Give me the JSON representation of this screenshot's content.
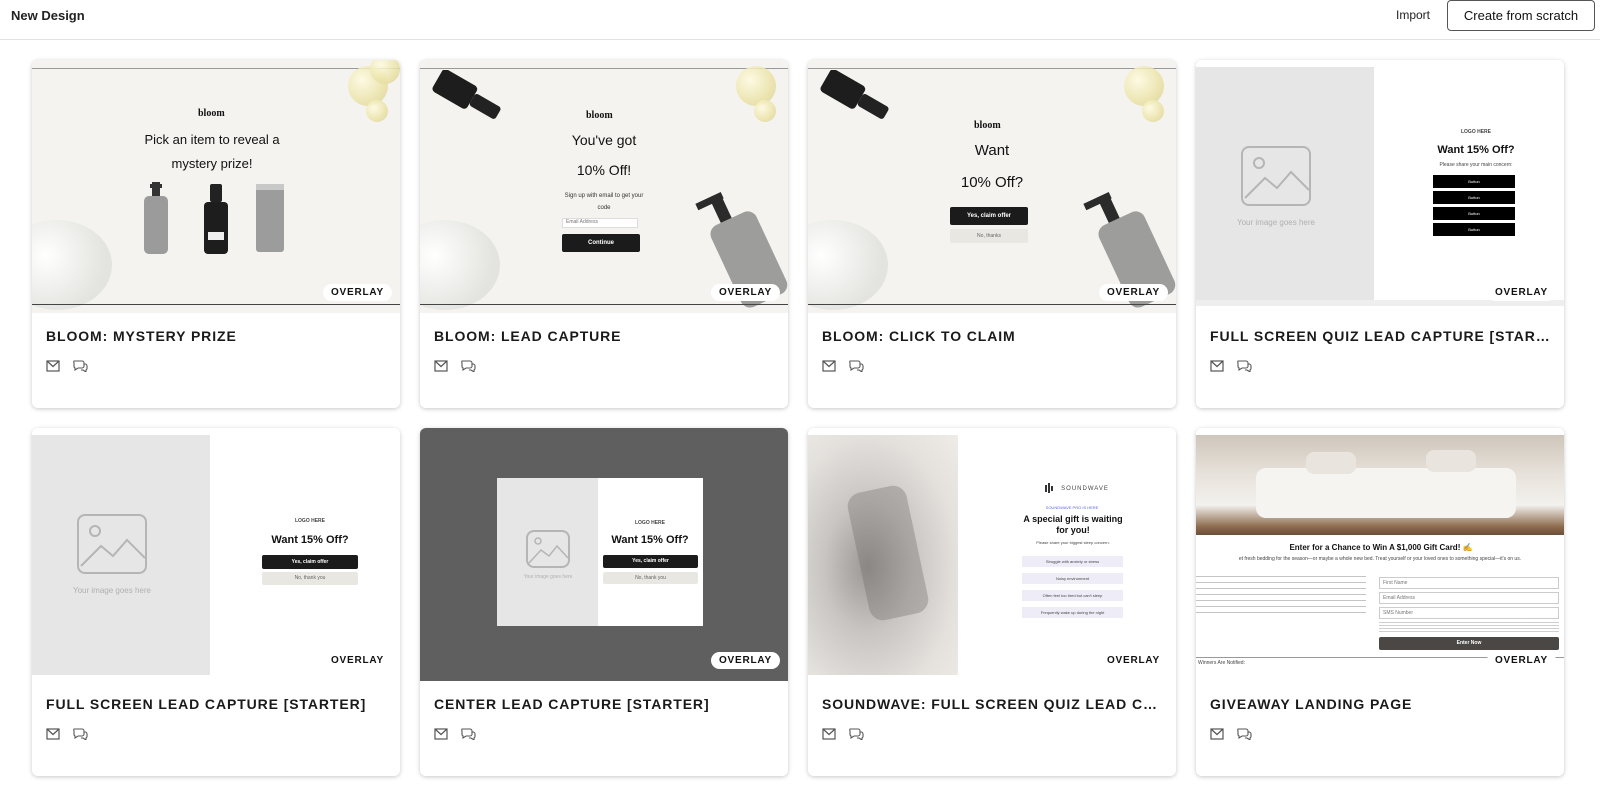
{
  "topbar": {
    "title": "New Design",
    "import_label": "Import",
    "create_label": "Create from scratch"
  },
  "cards": [
    {
      "title": "BLOOM: MYSTERY PRIZE",
      "badge": "OVERLAY",
      "preview": {
        "brand": "bloom",
        "headline": "Pick an item to reveal a mystery prize!"
      }
    },
    {
      "title": "BLOOM: LEAD CAPTURE",
      "badge": "OVERLAY",
      "preview": {
        "brand": "bloom",
        "line1": "You've got",
        "line2": "10% Off!",
        "sub": "Sign up with email to get your code",
        "input": "Email Address",
        "button": "Continue"
      }
    },
    {
      "title": "BLOOM: CLICK TO CLAIM",
      "badge": "OVERLAY",
      "preview": {
        "brand": "bloom",
        "line1": "Want",
        "line2": "10% Off?",
        "button": "Yes, claim offer",
        "secondary": "No, thanks"
      }
    },
    {
      "title": "FULL SCREEN QUIZ LEAD CAPTURE [STARTER]",
      "badge": "OVERLAY",
      "preview": {
        "logo": "LOGO HERE",
        "headline": "Want 15% Off?",
        "sub": "Please share your main concern:",
        "buttons": [
          "Button",
          "Button",
          "Button",
          "Button"
        ],
        "image_caption": "Your image goes here"
      }
    },
    {
      "title": "FULL SCREEN LEAD CAPTURE [STARTER]",
      "badge": "OVERLAY",
      "preview": {
        "logo": "LOGO HERE",
        "headline": "Want 15% Off?",
        "button": "Yes, claim offer",
        "secondary": "No, thank you",
        "image_caption": "Your image goes here"
      }
    },
    {
      "title": "CENTER LEAD CAPTURE [STARTER]",
      "badge": "OVERLAY",
      "preview": {
        "logo": "LOGO HERE",
        "headline": "Want 15% Off?",
        "button": "Yes, claim offer",
        "secondary": "No, thank you",
        "image_caption": "Your image goes here"
      }
    },
    {
      "title": "SOUNDWAVE: FULL SCREEN QUIZ LEAD CAPTU...",
      "badge": "OVERLAY",
      "preview": {
        "brand": "SOUNDWAVE",
        "kicker": "SOUNDWAVE PRO IS HERE",
        "headline": "A special gift is waiting for you!",
        "sub": "Please share your biggest sleep concern:",
        "options": [
          "Struggle with anxiety or stress",
          "Noisy environment",
          "Often feel too tired but can't sleep",
          "Frequently wake up during the night"
        ]
      }
    },
    {
      "title": "GIVEAWAY LANDING PAGE",
      "badge": "OVERLAY",
      "preview": {
        "headline": "Enter for a Chance to Win A $1,000 Gift Card! ✍",
        "sub": "et fresh bedding for the season—or maybe a whole new bed. Treat yourself or your loved ones to something special—it's on us.",
        "fields": [
          "First Name",
          "Email Address",
          "SMS Number"
        ],
        "button": "Enter Now",
        "footer": "Winners Are Notified:"
      }
    }
  ],
  "icons": {
    "email": "mail-icon",
    "sms": "chat-bubbles-icon"
  },
  "colors": {
    "dark_button": "#1b1b1b",
    "placeholder_gray": "#e6e6e6",
    "center_backdrop": "#5f5f5f"
  }
}
